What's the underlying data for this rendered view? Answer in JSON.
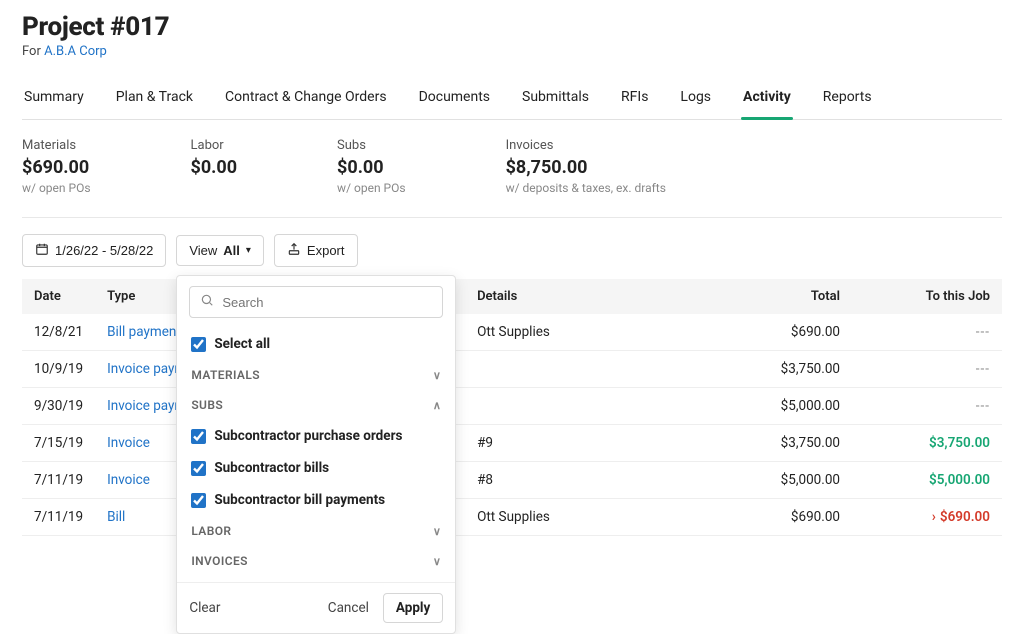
{
  "header": {
    "title": "Project #017",
    "subtitle_prefix": "For ",
    "subtitle_link": "A.B.A Corp"
  },
  "tabs": [
    "Summary",
    "Plan & Track",
    "Contract & Change Orders",
    "Documents",
    "Submittals",
    "RFIs",
    "Logs",
    "Activity",
    "Reports"
  ],
  "active_tab_index": 7,
  "summary": {
    "materials": {
      "label": "Materials",
      "value": "$690.00",
      "sub": "w/ open POs"
    },
    "labor": {
      "label": "Labor",
      "value": "$0.00",
      "sub": ""
    },
    "subs": {
      "label": "Subs",
      "value": "$0.00",
      "sub": "w/ open POs"
    },
    "invoices": {
      "label": "Invoices",
      "value": "$8,750.00",
      "sub": "w/ deposits & taxes, ex. drafts"
    }
  },
  "controls": {
    "date_range": "1/26/22 - 5/28/22",
    "view_label": "View",
    "view_value": "All",
    "export_label": "Export"
  },
  "view_filter": {
    "search_placeholder": "Search",
    "select_all": "Select all",
    "groups": {
      "materials": {
        "label": "MATERIALS",
        "expanded": false
      },
      "subs": {
        "label": "SUBS",
        "expanded": true,
        "options": [
          {
            "label": "Subcontractor purchase orders",
            "checked": true
          },
          {
            "label": "Subcontractor bills",
            "checked": true
          },
          {
            "label": "Subcontractor bill payments",
            "checked": true
          }
        ]
      },
      "labor": {
        "label": "LABOR",
        "expanded": false
      },
      "invoices": {
        "label": "INVOICES",
        "expanded": false
      }
    },
    "footer": {
      "clear": "Clear",
      "cancel": "Cancel",
      "apply": "Apply"
    }
  },
  "table": {
    "columns": {
      "date": "Date",
      "type": "Type",
      "details": "Details",
      "total": "Total",
      "to_job": "To this Job"
    },
    "rows": [
      {
        "date": "12/8/21",
        "type": "Bill payment",
        "details": "Ott Supplies",
        "total": "$690.00",
        "to_job": "---",
        "to_job_style": "dash"
      },
      {
        "date": "10/9/19",
        "type": "Invoice payme",
        "details": "",
        "total": "$3,750.00",
        "to_job": "---",
        "to_job_style": "dash"
      },
      {
        "date": "9/30/19",
        "type": "Invoice payme",
        "details": "",
        "total": "$5,000.00",
        "to_job": "---",
        "to_job_style": "dash"
      },
      {
        "date": "7/15/19",
        "type": "Invoice",
        "details": "#9",
        "total": "$3,750.00",
        "to_job": "$3,750.00",
        "to_job_style": "green"
      },
      {
        "date": "7/11/19",
        "type": "Invoice",
        "details": "#8",
        "total": "$5,000.00",
        "to_job": "$5,000.00",
        "to_job_style": "green"
      },
      {
        "date": "7/11/19",
        "type": "Bill",
        "details": "Ott Supplies",
        "total": "$690.00",
        "to_job": "$690.00",
        "to_job_style": "red"
      }
    ]
  }
}
